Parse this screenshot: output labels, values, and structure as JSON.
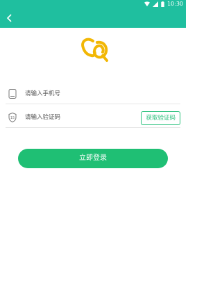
{
  "status_bar": {
    "time": "10:30",
    "icons": [
      "wifi-icon",
      "signal-icon",
      "battery-icon"
    ]
  },
  "toolbar": {
    "back_icon": "chevron-left-icon"
  },
  "logo": {
    "icon": "cq-logo"
  },
  "form": {
    "phone_placeholder": "请输入手机号",
    "code_placeholder": "请输入验证码",
    "get_code_label": "获取验证码",
    "login_label": "立即登录"
  },
  "colors": {
    "header": "#1fbf9f",
    "accent_green": "#1fbf74",
    "logo_yellow": "#f2b705"
  }
}
